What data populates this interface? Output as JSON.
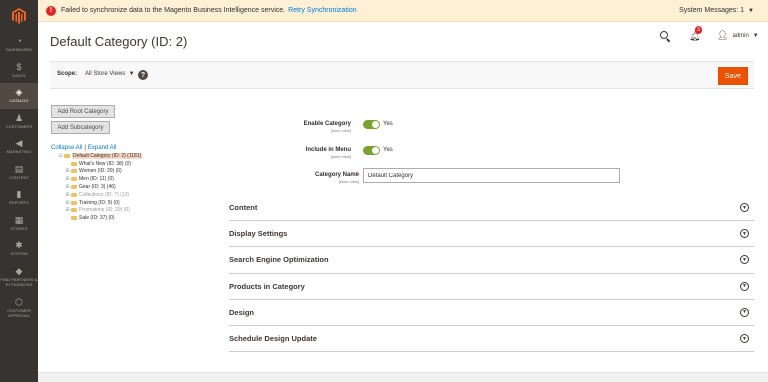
{
  "nav": {
    "items": [
      {
        "label": "Dashboard",
        "icon": "dashboard-icon",
        "glyph": "◔"
      },
      {
        "label": "Sales",
        "icon": "dollar-icon",
        "glyph": "$"
      },
      {
        "label": "Catalog",
        "icon": "box-icon",
        "glyph": "◈"
      },
      {
        "label": "Customers",
        "icon": "person-icon",
        "glyph": "♟"
      },
      {
        "label": "Marketing",
        "icon": "megaphone-icon",
        "glyph": "◀"
      },
      {
        "label": "Content",
        "icon": "content-icon",
        "glyph": "▤"
      },
      {
        "label": "Reports",
        "icon": "bar-chart-icon",
        "glyph": "▮"
      },
      {
        "label": "Stores",
        "icon": "store-icon",
        "glyph": "▦"
      },
      {
        "label": "System",
        "icon": "gear-icon",
        "glyph": "✱"
      },
      {
        "label": "Find Partners & Extensions",
        "icon": "extensions-icon",
        "glyph": "◆"
      },
      {
        "label": "Customer Approval",
        "icon": "approval-icon",
        "glyph": "⬡"
      }
    ]
  },
  "system_message": {
    "text": "Failed to synchronize data to the Magento Business Intelligence service.",
    "link": "Retry Synchronization",
    "right_label": "System Messages: 1"
  },
  "header": {
    "title": "Default Category (ID: 2)",
    "notification_count": "3",
    "user": "admin"
  },
  "scope": {
    "label": "Scope:",
    "value": "All Store Views"
  },
  "save_label": "Save",
  "buttons": {
    "add_root": "Add Root Category",
    "add_sub": "Add Subcategory"
  },
  "tree": {
    "collapse_all": "Collapse All",
    "separator": "|",
    "expand_all": "Expand All",
    "nodes": [
      {
        "label": "Default Category (ID: 2) (1181)",
        "expander": "⊟"
      },
      {
        "label": "What's New (ID: 38) (0)",
        "expander": ""
      },
      {
        "label": "Women (ID: 20) (0)",
        "expander": "⊞"
      },
      {
        "label": "Men (ID: 11) (0)",
        "expander": "⊞"
      },
      {
        "label": "Gear (ID: 3) (46)",
        "expander": "⊞"
      },
      {
        "label": "Collections (ID: 7) (13)",
        "expander": "⊞"
      },
      {
        "label": "Training (ID: 9) (0)",
        "expander": "⊞"
      },
      {
        "label": "Promotions (ID: 29) (0)",
        "expander": "⊞"
      },
      {
        "label": "Sale (ID: 37) (0)",
        "expander": ""
      }
    ]
  },
  "form": {
    "enable_label": "Enable Category",
    "enable_scope": "[store view]",
    "enable_value": "Yes",
    "menu_label": "Include in Menu",
    "menu_scope": "[store view]",
    "menu_value": "Yes",
    "name_label": "Category Name",
    "name_required": "*",
    "name_scope": "[store view]",
    "name_value": "Default Category"
  },
  "sections": [
    "Content",
    "Display Settings",
    "Search Engine Optimization",
    "Products in Category",
    "Design",
    "Schedule Design Update"
  ]
}
